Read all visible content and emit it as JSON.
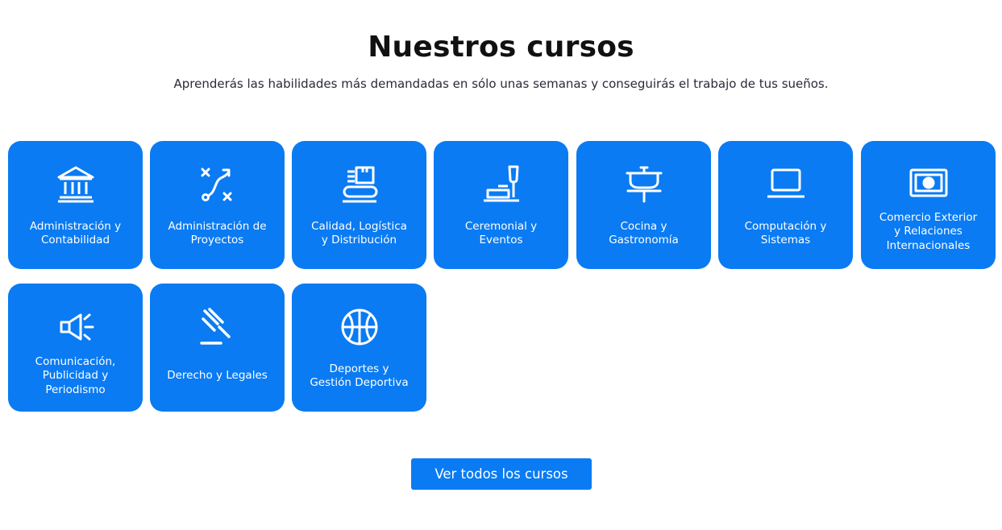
{
  "header": {
    "title": "Nuestros cursos",
    "subtitle": "Aprenderás las habilidades más demandadas en sólo unas semanas y conseguirás el trabajo de tus sueños."
  },
  "courses": [
    {
      "label": "Administración y\nContabilidad",
      "icon": "bank-building-icon"
    },
    {
      "label": "Administración de\nProyectos",
      "icon": "strategy-path-icon"
    },
    {
      "label": "Calidad, Logística\ny Distribución",
      "icon": "conveyor-box-icon"
    },
    {
      "label": "Ceremonial y\nEventos",
      "icon": "champagne-glass-icon"
    },
    {
      "label": "Cocina y\nGastronomía",
      "icon": "cooking-pot-icon"
    },
    {
      "label": "Computación y\nSistemas",
      "icon": "laptop-icon"
    },
    {
      "label": "Comercio Exterior\ny Relaciones\nInternacionales",
      "icon": "banknote-icon"
    },
    {
      "label": "Comunicación,\nPublicidad y\nPeriodismo",
      "icon": "megaphone-icon"
    },
    {
      "label": "Derecho y Legales",
      "icon": "gavel-icon"
    },
    {
      "label": "Deportes y\nGestión Deportiva",
      "icon": "basketball-icon"
    }
  ],
  "cta": {
    "label": "Ver todos los cursos"
  },
  "colors": {
    "accent": "#0a7bf3",
    "title": "#111111",
    "text": "#2a2a3a"
  }
}
